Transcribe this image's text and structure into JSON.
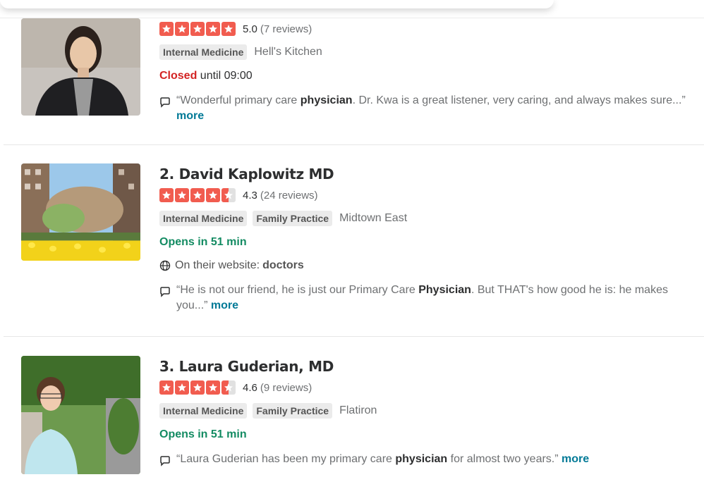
{
  "listings": [
    {
      "name": "",
      "rating": "5.0",
      "rating_value": 5.0,
      "reviews": "(7 reviews)",
      "tags": [
        "Internal Medicine"
      ],
      "neighborhood": "Hell's Kitchen",
      "status_word": "Closed",
      "status_rest": "until 09:00",
      "snippet_before": "“Wonderful primary care ",
      "snippet_bold": "physician",
      "snippet_after": ". Dr. Kwa is a great listener, very caring, and always makes sure...”",
      "more": "more"
    },
    {
      "name": "2. David Kaplowitz MD",
      "rating": "4.3",
      "rating_value": 4.5,
      "reviews": "(24 reviews)",
      "tags": [
        "Internal Medicine",
        "Family Practice"
      ],
      "neighborhood": "Midtown East",
      "status_word": "Opens in 51 min",
      "website_prefix": "On their website:",
      "website_term": "doctors",
      "snippet_before": "“He is not our friend, he is just our Primary Care ",
      "snippet_bold": "Physician",
      "snippet_after": ". But THAT's how good he is: he makes you...”",
      "more": "more"
    },
    {
      "name": "3. Laura Guderian, MD",
      "rating": "4.6",
      "rating_value": 4.5,
      "reviews": "(9 reviews)",
      "tags": [
        "Internal Medicine",
        "Family Practice"
      ],
      "neighborhood": "Flatiron",
      "status_word": "Opens in 51 min",
      "snippet_before": "“Laura Guderian has been my primary care ",
      "snippet_bold": "physician",
      "snippet_after": " for almost two years.”",
      "more": "more"
    }
  ],
  "colors": {
    "star": "#f15c4f",
    "star_empty": "#e1e1e1",
    "closed": "#d32323",
    "open": "#138b62",
    "link": "#027a97"
  },
  "icons": {
    "star": "star-icon",
    "review": "speech-bubble-icon",
    "website": "globe-icon"
  }
}
